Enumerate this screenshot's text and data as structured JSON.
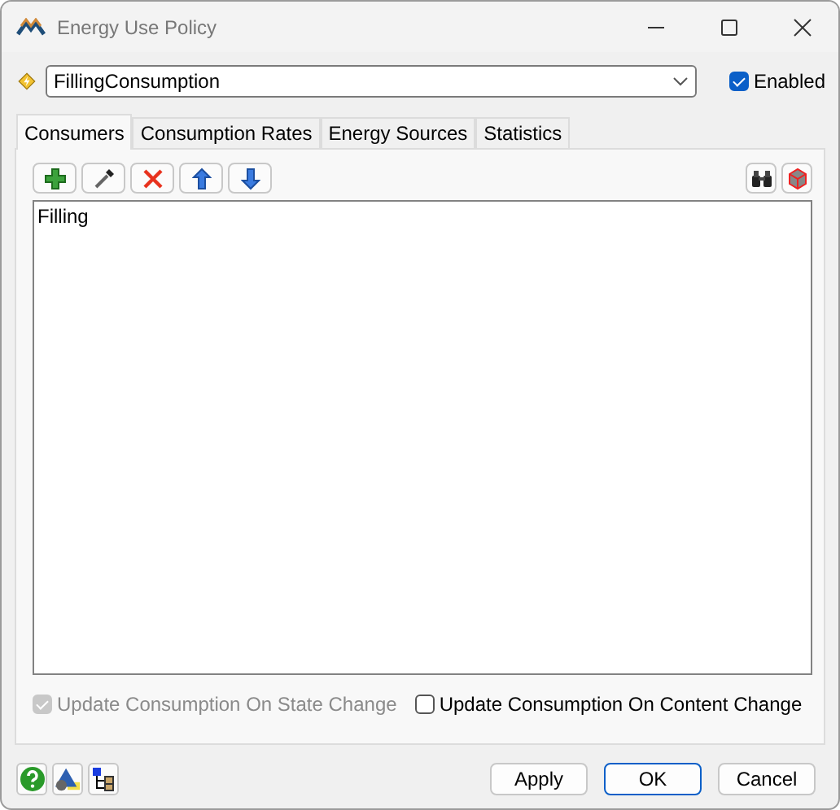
{
  "window": {
    "title": "Energy Use Policy"
  },
  "policy": {
    "value": "FillingConsumption"
  },
  "enabled": {
    "label": "Enabled",
    "checked": true
  },
  "tabs": [
    {
      "label": "Consumers",
      "selected": true
    },
    {
      "label": "Consumption Rates",
      "selected": false
    },
    {
      "label": "Energy Sources",
      "selected": false
    },
    {
      "label": "Statistics",
      "selected": false
    }
  ],
  "consumers": [
    "Filling"
  ],
  "options": [
    {
      "label": "Update Consumption On State Change",
      "checked": true,
      "disabled": true
    },
    {
      "label": "Update Consumption On Content Change",
      "checked": false,
      "disabled": false
    }
  ],
  "buttons": [
    {
      "label": "Apply",
      "default": false
    },
    {
      "label": "OK",
      "default": true
    },
    {
      "label": "Cancel",
      "default": false
    }
  ]
}
